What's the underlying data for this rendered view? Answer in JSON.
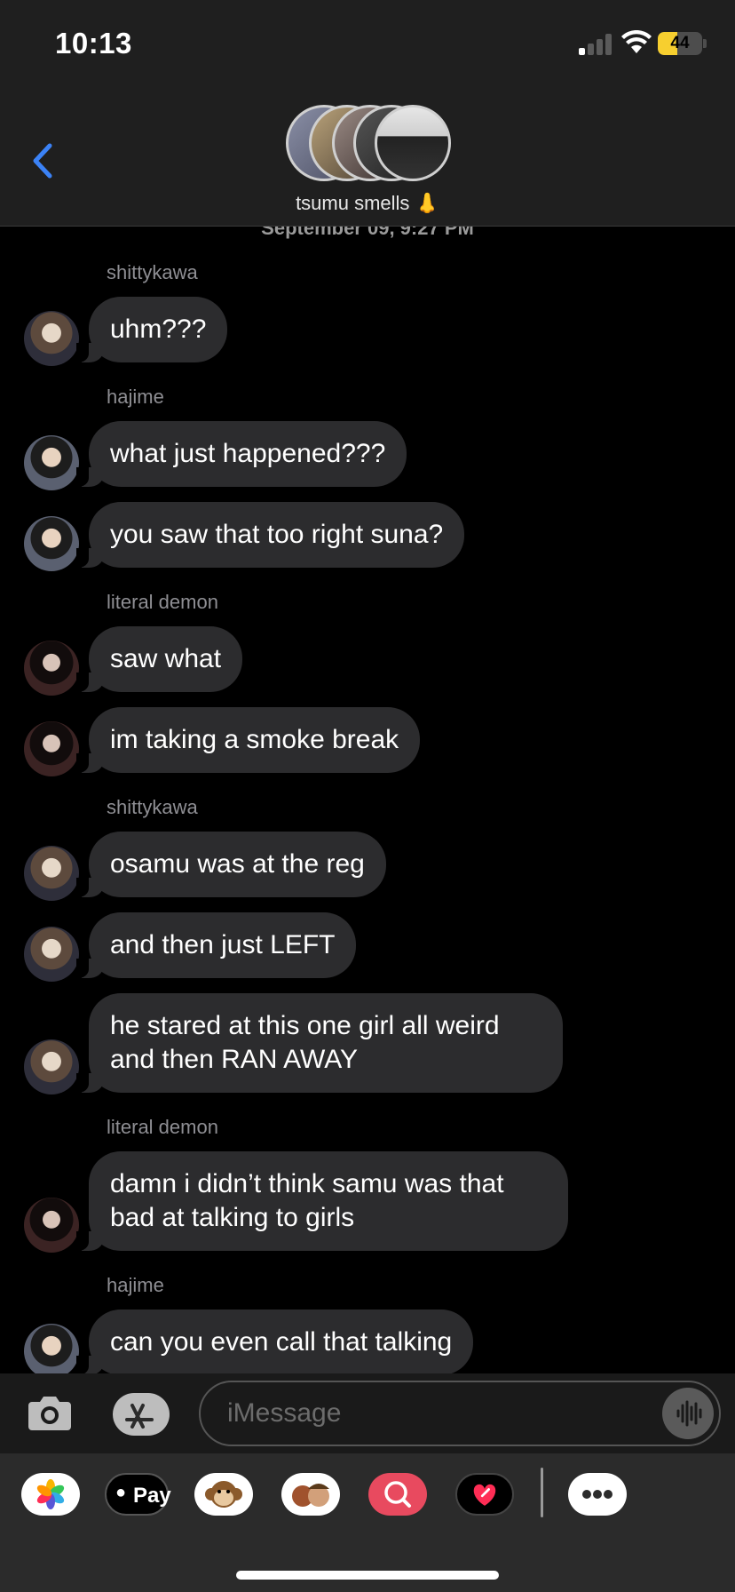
{
  "status_bar": {
    "time": "10:13",
    "battery": "44"
  },
  "header": {
    "group_name": "tsumu smells 👃",
    "timestamp_peek": "September 09, 9:27 PM"
  },
  "messages": [
    {
      "type": "sender",
      "name": "shittykawa"
    },
    {
      "type": "bubble",
      "text": "uhm???",
      "avatar": "shittykawa"
    },
    {
      "type": "sender",
      "name": "hajime"
    },
    {
      "type": "bubble",
      "text": "what just happened???",
      "avatar": "hajime"
    },
    {
      "type": "bubble",
      "text": "you saw that too right suna?",
      "avatar": "hajime"
    },
    {
      "type": "sender",
      "name": "literal demon"
    },
    {
      "type": "bubble",
      "text": "saw what",
      "avatar": "literal-demon"
    },
    {
      "type": "bubble",
      "text": "im taking a smoke break",
      "avatar": "literal-demon"
    },
    {
      "type": "sender",
      "name": "shittykawa"
    },
    {
      "type": "bubble",
      "text": "osamu was at the reg",
      "avatar": "shittykawa"
    },
    {
      "type": "bubble",
      "text": "and then just LEFT",
      "avatar": "shittykawa"
    },
    {
      "type": "bubble",
      "text": "he stared at this one girl all weird and then RAN AWAY",
      "avatar": "shittykawa"
    },
    {
      "type": "sender",
      "name": "literal demon"
    },
    {
      "type": "bubble",
      "text": "damn i didn’t think samu was that bad at talking to girls",
      "avatar": "literal-demon"
    },
    {
      "type": "sender",
      "name": "hajime"
    },
    {
      "type": "bubble",
      "text": "can you even call that talking",
      "avatar": "hajime"
    }
  ],
  "input": {
    "placeholder": "iMessage"
  },
  "icons": {
    "back": "chevron-left-icon",
    "camera": "camera-icon",
    "appstore": "app-store-icon",
    "audio": "waveform-icon",
    "more": "ellipsis-icon"
  },
  "drawer_apps": [
    {
      "name": "photos",
      "label": ""
    },
    {
      "name": "apple-pay",
      "label": "Pay"
    },
    {
      "name": "memoji-monkey",
      "label": ""
    },
    {
      "name": "memoji",
      "label": ""
    },
    {
      "name": "image-search",
      "label": ""
    },
    {
      "name": "heart-app",
      "label": ""
    },
    {
      "name": "more",
      "label": ""
    }
  ],
  "colors": {
    "bubble": "#2c2c2e",
    "header": "#1f1f1f",
    "accent_blue": "#3b82f6",
    "battery_yellow": "#f7cf2f"
  }
}
